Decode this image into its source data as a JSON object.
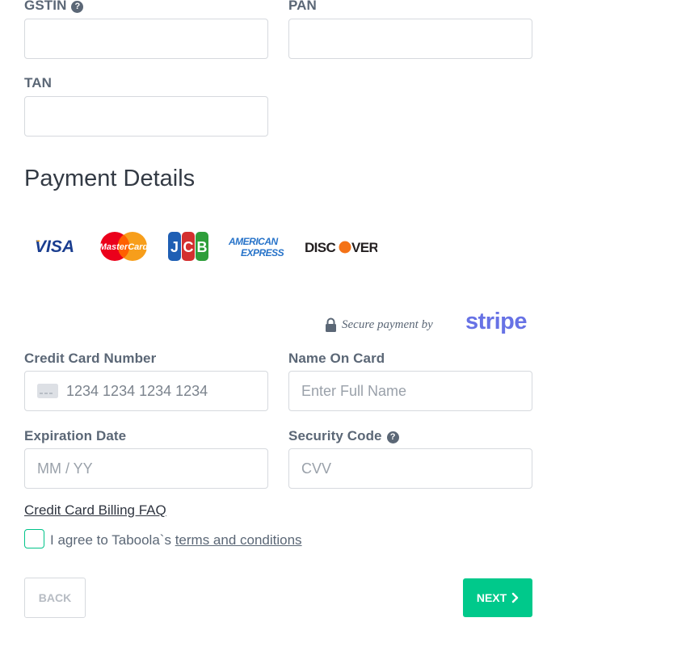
{
  "tax_fields": {
    "gstin_label": "GSTIN",
    "pan_label": "PAN",
    "tan_label": "TAN",
    "gstin_value": "",
    "pan_value": "",
    "tan_value": ""
  },
  "payment": {
    "title": "Payment Details",
    "card_brands": [
      "VISA",
      "MasterCard",
      "JCB",
      "AMERICAN EXPRESS",
      "DISCOVER"
    ],
    "secure_text": "Secure payment by",
    "provider": "stripe",
    "card_number_label": "Credit Card Number",
    "card_number_placeholder": "1234 1234 1234 1234",
    "name_label": "Name On Card",
    "name_placeholder": "Enter Full Name",
    "expiry_label": "Expiration Date",
    "expiry_placeholder": "MM / YY",
    "cvv_label": "Security Code",
    "cvv_placeholder": "CVV",
    "faq_link": "Credit Card Billing FAQ",
    "agree_prefix": "I agree to Taboola`s ",
    "agree_link": "terms and conditions",
    "agree_checked": false
  },
  "actions": {
    "back_label": "BACK",
    "next_label": "NEXT"
  },
  "colors": {
    "accent": "#00c98b",
    "stripe": "#6772e5",
    "label": "#5b6776"
  }
}
